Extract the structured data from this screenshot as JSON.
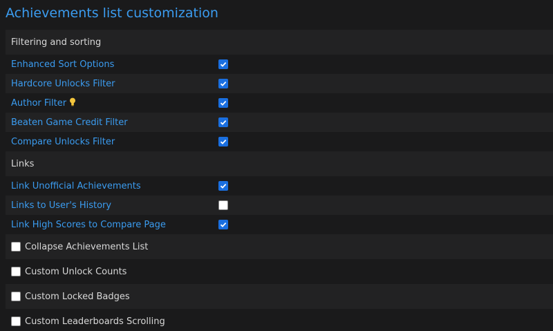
{
  "title": "Achievements list customization",
  "sections": [
    {
      "heading": "Filtering and sorting",
      "options": [
        {
          "label": "Enhanced Sort Options",
          "checked": true
        },
        {
          "label": "Hardcore Unlocks Filter",
          "checked": true
        },
        {
          "label": "Author Filter",
          "checked": true,
          "icon": "lightbulb-icon"
        },
        {
          "label": "Beaten Game Credit Filter",
          "checked": true
        },
        {
          "label": "Compare Unlocks Filter",
          "checked": true
        }
      ]
    },
    {
      "heading": "Links",
      "options": [
        {
          "label": "Link Unofficial Achievements",
          "checked": true
        },
        {
          "label": "Links to User's History",
          "checked": false
        },
        {
          "label": "Link High Scores to Compare Page",
          "checked": true
        }
      ]
    }
  ],
  "standalone": [
    {
      "label": "Collapse Achievements List",
      "checked": false
    },
    {
      "label": "Custom Unlock Counts",
      "checked": false
    },
    {
      "label": "Custom Locked Badges",
      "checked": false
    },
    {
      "label": "Custom Leaderboards Scrolling",
      "checked": false
    }
  ],
  "colors": {
    "link": "#3b9cf0",
    "checkbox_on": "#1a6fe0",
    "row_dark": "#222223",
    "row_light": "#1a1a1b"
  }
}
